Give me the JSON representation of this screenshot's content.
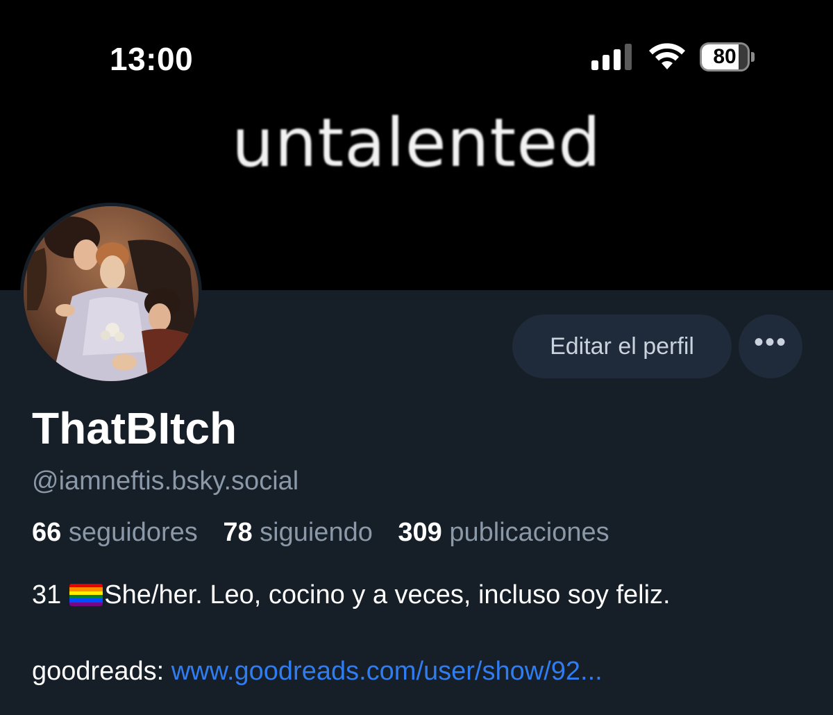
{
  "status_bar": {
    "time": "13:00",
    "battery": "80",
    "battery_level": 0.8,
    "signal_icon": "cellular-signal-icon",
    "wifi_icon": "wifi-icon"
  },
  "banner": {
    "text": "untalented"
  },
  "actions": {
    "edit_label": "Editar el perfil",
    "more_label": "•••"
  },
  "profile": {
    "display_name": "ThatBItch",
    "handle": "@iamneftis.bsky.social",
    "stats": [
      {
        "count": "66",
        "label": "seguidores"
      },
      {
        "count": "78",
        "label": "siguiendo"
      },
      {
        "count": "309",
        "label": "publicaciones"
      }
    ],
    "bio_prefix": "31",
    "bio_text": "She/her. Leo, cocino y a veces, incluso soy feliz.",
    "link_label": "goodreads:",
    "link_text": "www.goodreads.com/user/show/92..."
  },
  "colors": {
    "background": "#161e27",
    "link": "#2f7df0",
    "button_bg": "#1f2b3b",
    "muted_text": "#8b98a8"
  }
}
